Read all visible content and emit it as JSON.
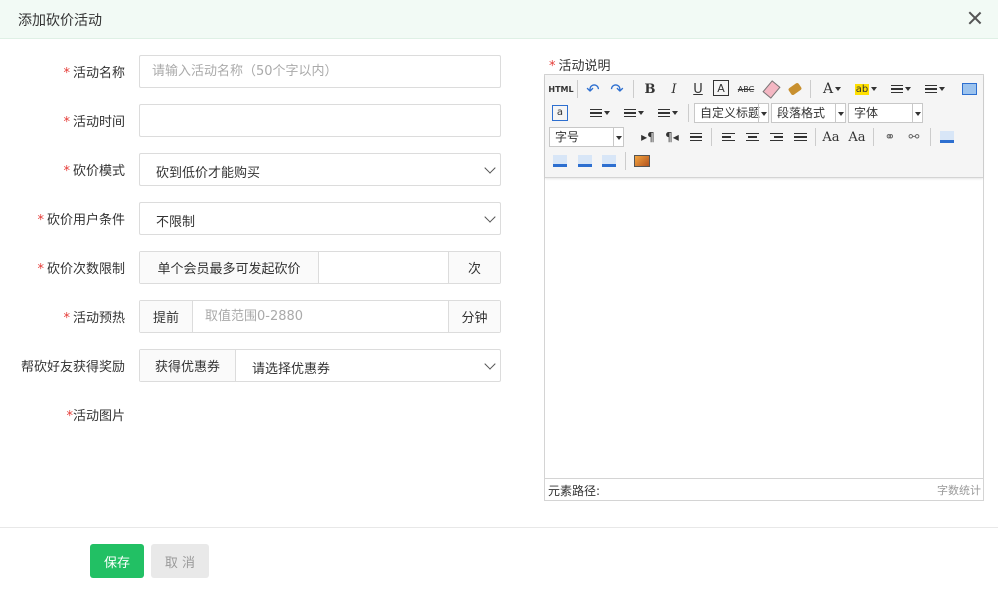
{
  "dialog": {
    "title": "添加砍价活动"
  },
  "form": {
    "name": {
      "label": "活动名称",
      "placeholder": "请输入活动名称（50个字以内）",
      "value": ""
    },
    "time": {
      "label": "活动时间",
      "value": ""
    },
    "mode": {
      "label": "砍价模式",
      "value": "砍到低价才能购买"
    },
    "user_condition": {
      "label": "砍价用户条件",
      "value": "不限制"
    },
    "count_limit": {
      "label": "砍价次数限制",
      "prefix": "单个会员最多可发起砍价",
      "value": "",
      "suffix": "次"
    },
    "preheat": {
      "label": "活动预热",
      "prefix": "提前",
      "placeholder": "取值范围0-2880",
      "suffix": "分钟"
    },
    "friend_reward": {
      "label": "帮砍好友获得奖励",
      "prefix": "获得优惠券",
      "value": "请选择优惠券"
    },
    "image": {
      "label": "活动图片"
    },
    "required_mark": "*"
  },
  "editor": {
    "label": "活动说明",
    "toolbar": {
      "html_label": "HTML",
      "bold": "B",
      "italic": "I",
      "underline": "U",
      "border_a": "A",
      "strike": "ABC",
      "font_color": "A",
      "custom_title": "自定义标题",
      "paragraph": "段落格式",
      "font_family": "字体",
      "font_size": "字号"
    },
    "status_path": "元素路径:",
    "word_count": "字数统计"
  },
  "footer": {
    "save": "保存",
    "cancel": "取 消"
  }
}
